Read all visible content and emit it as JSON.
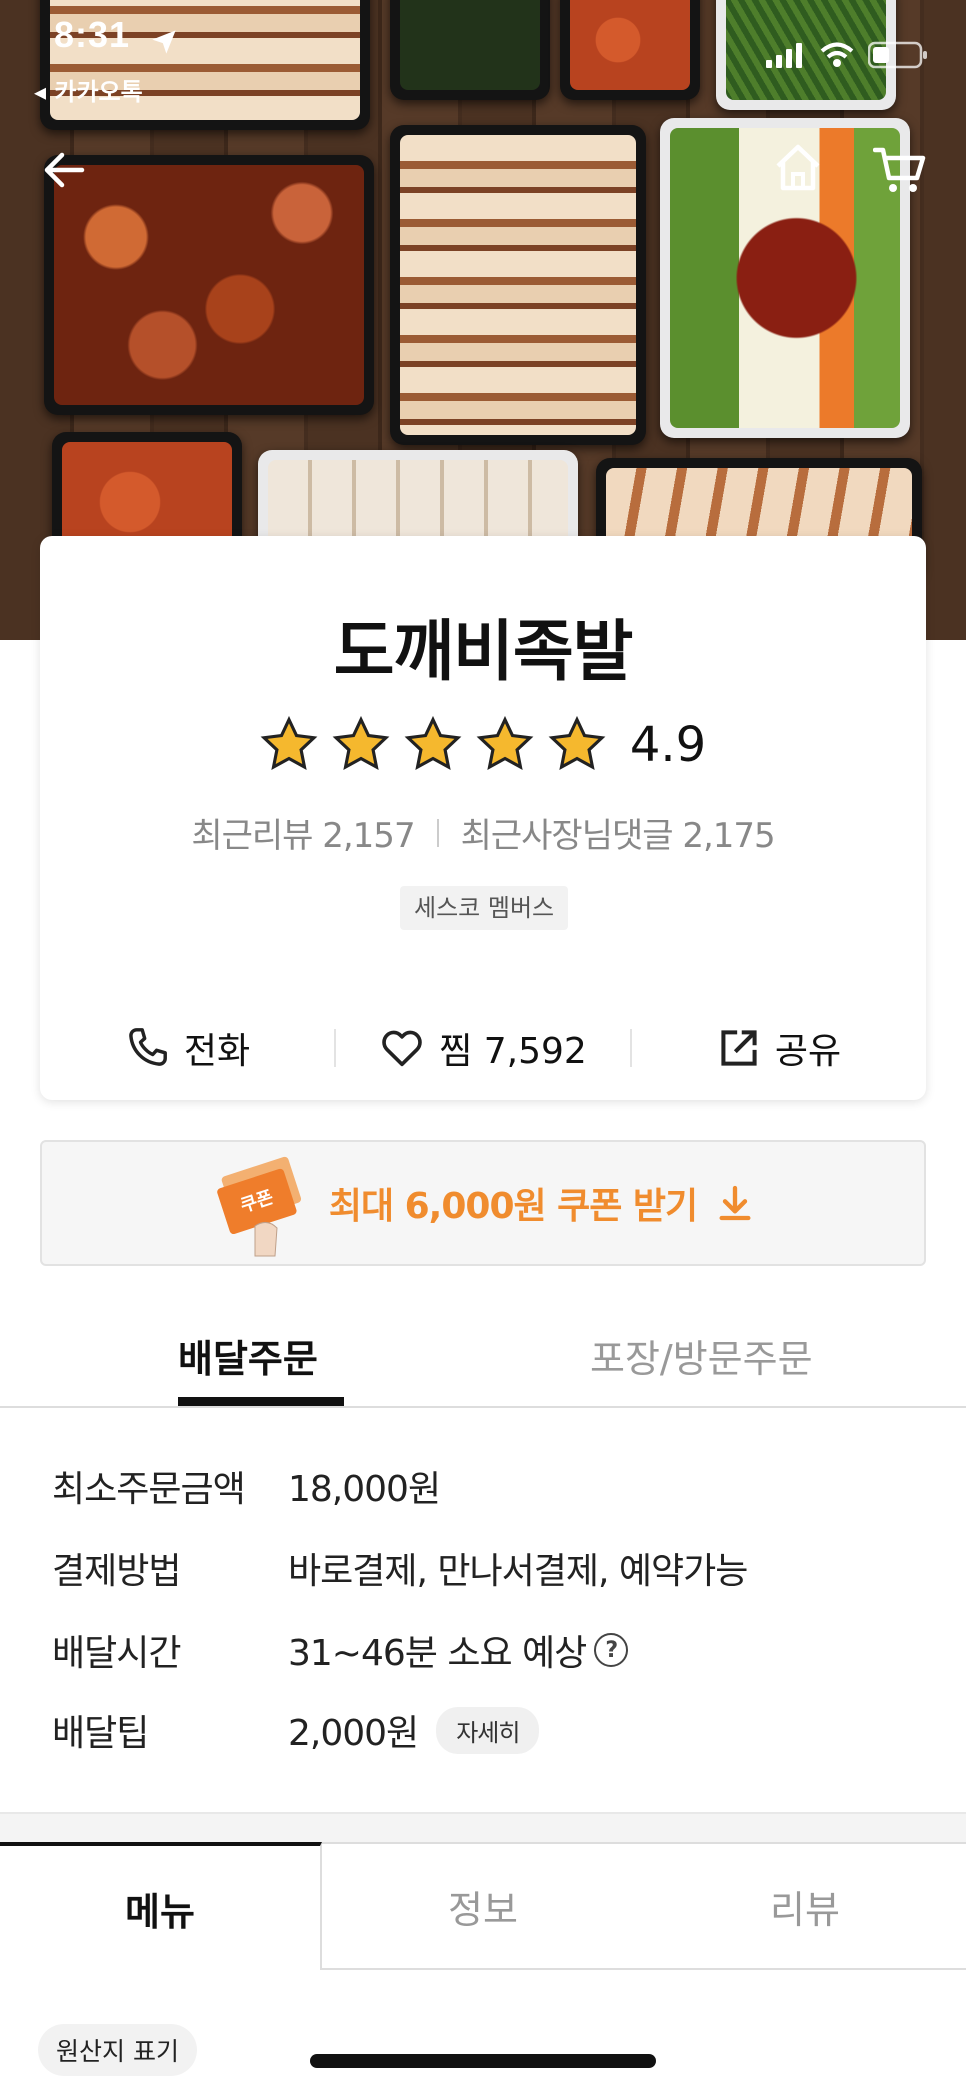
{
  "status_bar": {
    "time": "8:31",
    "back_app": "◂ 카카오톡"
  },
  "nav": {
    "back_icon": "arrow-left-icon",
    "home_icon": "home-icon",
    "cart_icon": "cart-icon"
  },
  "store": {
    "name": "도깨비족발",
    "rating": "4.9",
    "stars": 5,
    "recent_reviews": "최근리뷰 2,157",
    "owner_replies": "최근사장님댓글 2,175",
    "badge": "세스코 멤버스",
    "actions": {
      "call": "전화",
      "favorite": "찜 7,592",
      "share": "공유"
    }
  },
  "coupon": {
    "ticket_label": "쿠폰",
    "text": "최대 6,000원 쿠폰 받기"
  },
  "order_tabs": {
    "delivery": "배달주문",
    "pickup": "포장/방문주문"
  },
  "info": {
    "min_order_label": "최소주문금액",
    "min_order_value": "18,000원",
    "payment_label": "결제방법",
    "payment_value": "바로결제, 만나서결제, 예약가능",
    "delivery_time_label": "배달시간",
    "delivery_time_value": "31~46분 소요 예상",
    "delivery_tip_label": "배달팁",
    "delivery_tip_value": "2,000원",
    "detail_button": "자세히"
  },
  "menu_tabs": {
    "menu": "메뉴",
    "info": "정보",
    "review": "리뷰"
  },
  "origin_chip": "원산지 표기",
  "colors": {
    "accent_orange": "#f08c2e",
    "star_gold": "#f5b82e"
  }
}
